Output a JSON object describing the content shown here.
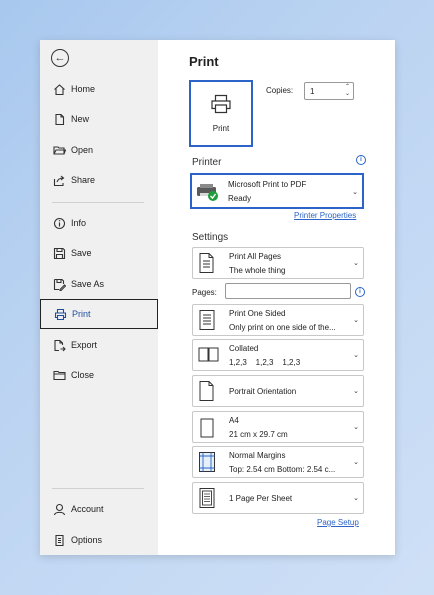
{
  "sidebar": {
    "items": [
      {
        "label": "Home",
        "icon": "home-icon"
      },
      {
        "label": "New",
        "icon": "new-document-icon"
      },
      {
        "label": "Open",
        "icon": "folder-open-icon"
      },
      {
        "label": "Share",
        "icon": "share-icon"
      },
      {
        "label": "Info",
        "icon": "info-icon"
      },
      {
        "label": "Save",
        "icon": "save-icon"
      },
      {
        "label": "Save As",
        "icon": "save-as-icon"
      },
      {
        "label": "Print",
        "icon": "printer-icon"
      },
      {
        "label": "Export",
        "icon": "export-icon"
      },
      {
        "label": "Close",
        "icon": "close-folder-icon"
      },
      {
        "label": "Account",
        "icon": "account-icon"
      },
      {
        "label": "Options",
        "icon": "options-icon"
      }
    ]
  },
  "print": {
    "title": "Print",
    "button_label": "Print",
    "copies_label": "Copies:",
    "copies_value": "1"
  },
  "printer": {
    "section_title": "Printer",
    "name": "Microsoft Print to PDF",
    "status": "Ready",
    "properties_link": "Printer Properties"
  },
  "settings": {
    "section_title": "Settings",
    "pages_label": "Pages:",
    "pages_value": "",
    "items": [
      {
        "line1": "Print All Pages",
        "line2": "The whole thing"
      },
      {
        "line1": "Print One Sided",
        "line2": "Only print on one side of the..."
      },
      {
        "line1": "Collated",
        "line2": "1,2,3    1,2,3    1,2,3"
      },
      {
        "line1": "Portrait Orientation",
        "line2": ""
      },
      {
        "line1": "A4",
        "line2": "21 cm x 29.7 cm"
      },
      {
        "line1": "Normal Margins",
        "line2": "Top: 2.54 cm Bottom: 2.54 c..."
      },
      {
        "line1": "1 Page Per Sheet",
        "line2": ""
      }
    ],
    "page_setup_link": "Page Setup"
  },
  "colors": {
    "accent": "#2b63c8",
    "sidebar_bg": "#f0f0f0",
    "status_ok": "#1f9d3a"
  }
}
